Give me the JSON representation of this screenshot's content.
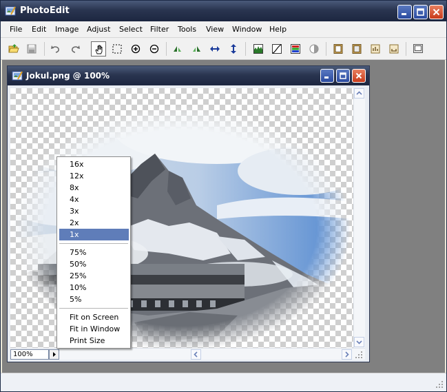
{
  "app": {
    "title": "PhotoEdit"
  },
  "menu": [
    "File",
    "Edit",
    "Image",
    "Adjust",
    "Select",
    "Filter",
    "Tools",
    "View",
    "Window",
    "Help"
  ],
  "toolbar": {
    "tools": [
      "open-icon",
      "save-icon",
      "undo-icon",
      "redo-icon",
      "hand-icon",
      "marquee-select-icon",
      "zoom-in-icon",
      "zoom-out-icon",
      "flip-left-icon",
      "flip-right-icon",
      "flip-horizontal-icon",
      "flip-vertical-icon",
      "histogram-icon",
      "curves-icon",
      "color-balance-icon",
      "brightness-icon",
      "frame-icon",
      "frame-fill-icon",
      "image-info-icon",
      "image-size-icon",
      "fullscreen-icon"
    ],
    "active_tool": "hand-icon"
  },
  "document": {
    "title": "Jokul.png @ 100%",
    "zoom_value": "100%"
  },
  "zoom_menu": {
    "items": [
      "16x",
      "12x",
      "8x",
      "4x",
      "3x",
      "2x",
      "1x",
      "75%",
      "50%",
      "25%",
      "10%",
      "5%",
      "Fit on Screen",
      "Fit in Window",
      "Print Size"
    ],
    "selected": "1x"
  },
  "colors": {
    "titlebar": "#2a3550",
    "selection": "#5f7db9",
    "workspace": "#808080",
    "close_button": "#c83a1a"
  }
}
